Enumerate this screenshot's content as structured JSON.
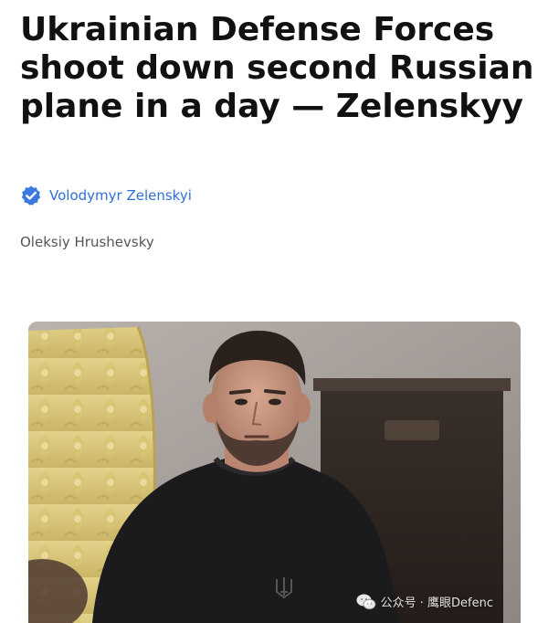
{
  "article": {
    "headline": "Ukrainian Defense Forces shoot down second Russian plane in a day — Zelenskyy",
    "source": {
      "name": "Volodymyr Zelenskyi",
      "verified_icon": "verified-badge-icon",
      "verified_color": "#3b78e0"
    },
    "author": "Oleksiy Hrushevsky"
  },
  "image": {
    "watermark": "公众号 · 鹰眼Defenc"
  },
  "colors": {
    "headline": "#111111",
    "source_link": "#2f6fd8",
    "author": "#555555"
  }
}
